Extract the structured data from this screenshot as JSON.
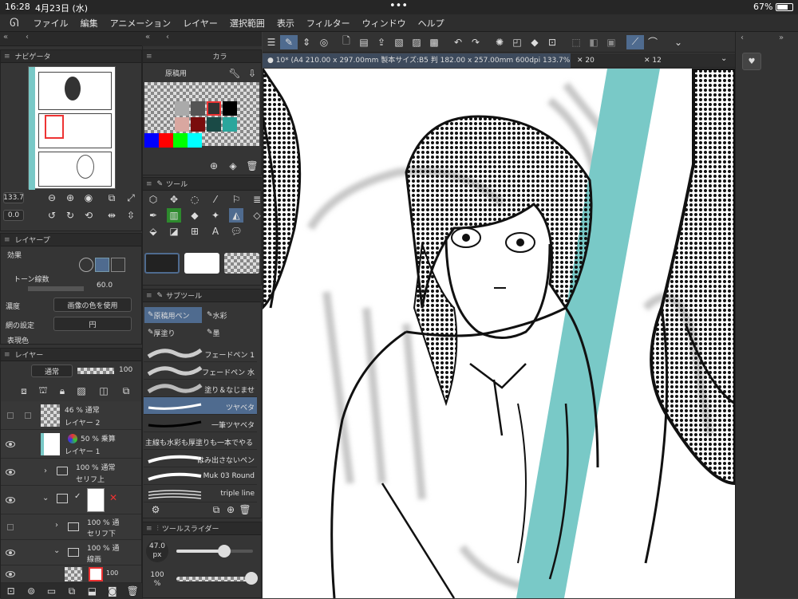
{
  "status": {
    "time": "16:28",
    "date": "4月23日 (水)",
    "battery": "67%",
    "dots": "•••"
  },
  "menu": [
    "ファイル",
    "編集",
    "アニメーション",
    "レイヤー",
    "選択範囲",
    "表示",
    "フィルター",
    "ウィンドウ",
    "ヘルプ"
  ],
  "navigator": {
    "title": "ナビゲータ",
    "zoom": "133.7",
    "angle": "0.0"
  },
  "color_panel": {
    "tab": "カラ",
    "set_name": "原稿用"
  },
  "tool_panel": {
    "title": "ツール"
  },
  "layer_property": {
    "title": "レイヤープ",
    "effect_label": "効果",
    "tone_lines_label": "トーン線数",
    "tone_lines_value": "60.0",
    "density_label": "濃度",
    "density_value": "画像の色を使用",
    "dot_setting_label": "網の設定",
    "dot_setting_value": "円",
    "expression_label": "表現色"
  },
  "layer_panel": {
    "title": "レイヤー",
    "blend": "通常",
    "opacity": "100",
    "layers": [
      {
        "opacity_mode": "46 % 通常",
        "name": "レイヤー 2"
      },
      {
        "opacity_mode": "50 % 乗算",
        "name": "レイヤー 1"
      },
      {
        "opacity_mode": "100 % 通常",
        "name": "セリフ上"
      },
      {
        "opacity_mode": "100 % 通",
        "name": "セリフ下"
      },
      {
        "opacity_mode": "100 % 通",
        "name": "線画"
      },
      {
        "opacity_mode": "100",
        "name": ""
      }
    ]
  },
  "subtool": {
    "title": "サブツール",
    "groups": [
      "原稿用ペン",
      "水彩",
      "厚塗り",
      "墨"
    ],
    "brushes": [
      "フェードペン 1",
      "フェードペン 水",
      "塗り＆なじませ",
      "ツヤベタ",
      "一筆ツヤベタ",
      "主線も水彩も厚塗りも一本でやる",
      "はみ出さないペン",
      "Muk 03 Round",
      "triple line"
    ]
  },
  "slider": {
    "title": "ツールスライダー",
    "size": "47.0",
    "size_unit": "px",
    "opacity": "100",
    "opacity_unit": "%",
    "size_fraction": 0.62,
    "opacity_fraction": 0.98
  },
  "canvas": {
    "tab_title": "10* (A4 210.00 x 297.00mm 製本サイズ:B5 判 182.00 x 257.00mm 600dpi 133.7%)",
    "tab2": "20",
    "tab3": "12"
  },
  "colors": {
    "accent": "#79c9c7",
    "panel": "#353535",
    "highlight": "#4f6b8f"
  }
}
